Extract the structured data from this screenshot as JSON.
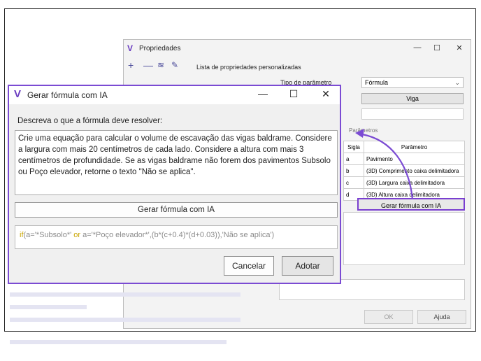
{
  "background_dialog": {
    "title": "Propriedades",
    "window_buttons": {
      "minimize": "—",
      "maximize": "☐",
      "close": "✕"
    },
    "toolbar": {
      "add": "+",
      "remove": "—",
      "list_label": "Lista de propriedades personalizadas"
    },
    "tipo_parametro_label": "Tipo de parâmetro",
    "tipo_parametro_value": "Fórmula",
    "viga_button": "Viga",
    "parametros_label": "Parâmetros",
    "table": {
      "headers": [
        "Sigla",
        "Parâmetro"
      ],
      "rows": [
        [
          "a",
          "Pavimento"
        ],
        [
          "b",
          "(3D) Comprimento caixa delimitadora"
        ],
        [
          "c",
          "(3D) Largura caixa delimitadora"
        ],
        [
          "d",
          "(3D) Altura caixa delimitadora"
        ]
      ]
    },
    "gerar_button": "Gerar fórmula com IA",
    "ok_button": "OK",
    "ajuda_button": "Ajuda"
  },
  "dialog": {
    "title": "Gerar fórmula com IA",
    "window_buttons": {
      "minimize": "—",
      "maximize": "☐",
      "close": "✕"
    },
    "prompt_label": "Descreva o que a fórmula deve resolver:",
    "prompt_text": "Crie uma equação para calcular o volume de escavação das vigas baldrame. Considere a largura com mais 20 centímetros de cada lado. Considere a altura com mais 3 centímetros de profundidade. Se as vigas baldrame não forem dos pavimentos Subsolo ou Poço elevador, retorne o texto \"Não se aplica\".",
    "generate_button": "Gerar fórmula com IA",
    "formula": {
      "kw_if": "if",
      "part1": "(a='*Subsolo*' ",
      "kw_or": "or",
      "part2": " a='*Poço elevador*',(b*(c+0.4)*(d+0.03)),'Não se aplica')"
    },
    "cancel_button": "Cancelar",
    "adopt_button": "Adotar"
  },
  "accent_color": "#7b4bd3"
}
